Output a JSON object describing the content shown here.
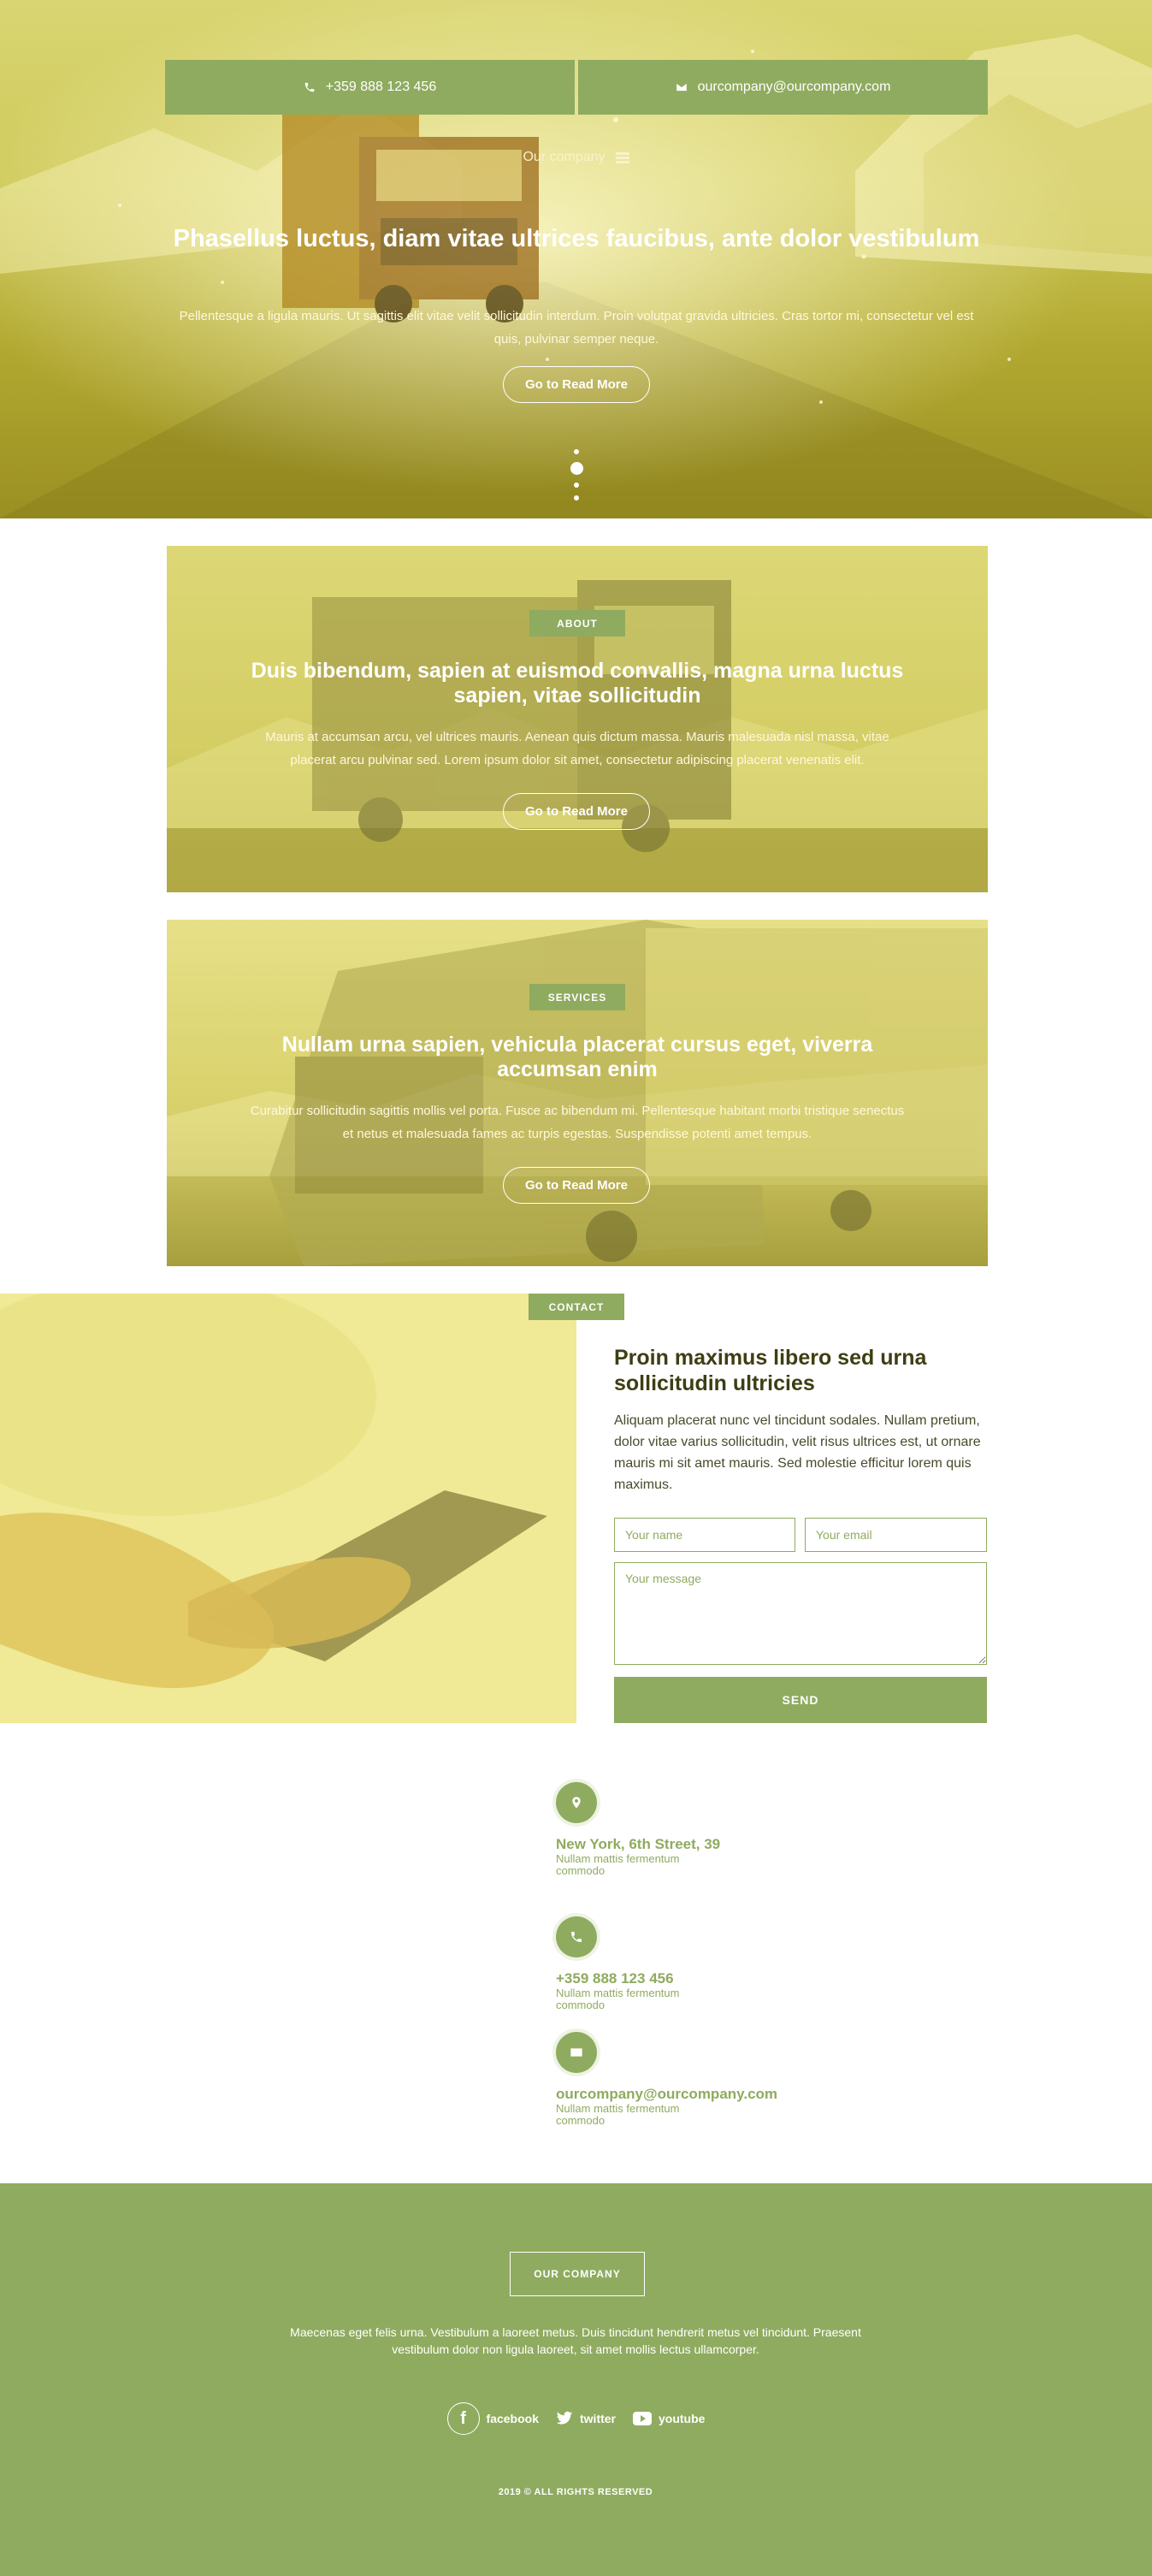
{
  "hero": {
    "phone": "+359 888 123 456",
    "email": "ourcompany@ourcompany.com",
    "brand": "Our company",
    "title": "Phasellus luctus, diam vitae ultrices faucibus, ante dolor vestibulum",
    "text": "Pellentesque a ligula mauris. Ut sagittis elit vitae velit sollicitudin interdum. Proin volutpat gravida ultricies. Cras tortor mi, consectetur vel est quis, pulvinar semper neque.",
    "button": "Go to Read More",
    "slides_count": 4,
    "active_slide": 2
  },
  "about": {
    "tag": "ABOUT",
    "title": "Duis bibendum, sapien at euismod convallis, magna urna luctus sapien, vitae sollicitudin",
    "text": "Mauris at accumsan arcu, vel ultrices mauris. Aenean quis dictum massa. Mauris malesuada nisl massa, vitae placerat arcu pulvinar sed. Lorem ipsum dolor sit amet, consectetur adipiscing placerat venenatis elit.",
    "button": "Go to Read More"
  },
  "services": {
    "tag": "SERVICES",
    "title": "Nullam urna sapien, vehicula placerat cursus eget, viverra accumsan enim",
    "text": "Curabitur sollicitudin sagittis mollis vel porta. Fusce ac bibendum mi. Pellentesque habitant morbi tristique senectus et netus et malesuada fames ac turpis egestas. Suspendisse potenti amet tempus.",
    "button": "Go to Read More"
  },
  "contact": {
    "tag": "CONTACT",
    "title": "Proin maximus libero sed urna sollicitudin ultricies",
    "text": "Aliquam placerat nunc vel tincidunt sodales. Nullam pretium, dolor vitae varius sollicitudin, velit risus ultrices est, ut ornare mauris mi sit amet mauris. Sed molestie efficitur lorem quis maximus.",
    "name_placeholder": "Your name",
    "email_placeholder": "Your email",
    "message_placeholder": "Your message",
    "send": "SEND"
  },
  "info": [
    {
      "icon": "map-marker-icon",
      "title": "New York,  6th Street, 39",
      "sub": "Nullam mattis fermentum commodo"
    },
    {
      "icon": "phone-icon",
      "title": "+359 888 123 456",
      "sub": "Nullam mattis fermentum commodo"
    },
    {
      "icon": "envelope-icon",
      "title": "ourcompany@ourcompany.com",
      "sub": "Nullam mattis fermentum commodo"
    }
  ],
  "footer": {
    "brand": "OUR COMPANY",
    "text": "Maecenas eget felis urna. Vestibulum a laoreet metus. Duis tincidunt hendrerit metus vel tincidunt. Praesent vestibulum dolor non ligula laoreet, sit amet mollis lectus ullamcorper.",
    "facebook": "facebook",
    "twitter": "twitter",
    "youtube": "youtube",
    "copyright": "2019 © ALL RIGHTS RESERVED"
  },
  "colors": {
    "accent": "#8fab5f",
    "overlay": "#e9e16f",
    "heading_dark": "#3e3e14"
  }
}
